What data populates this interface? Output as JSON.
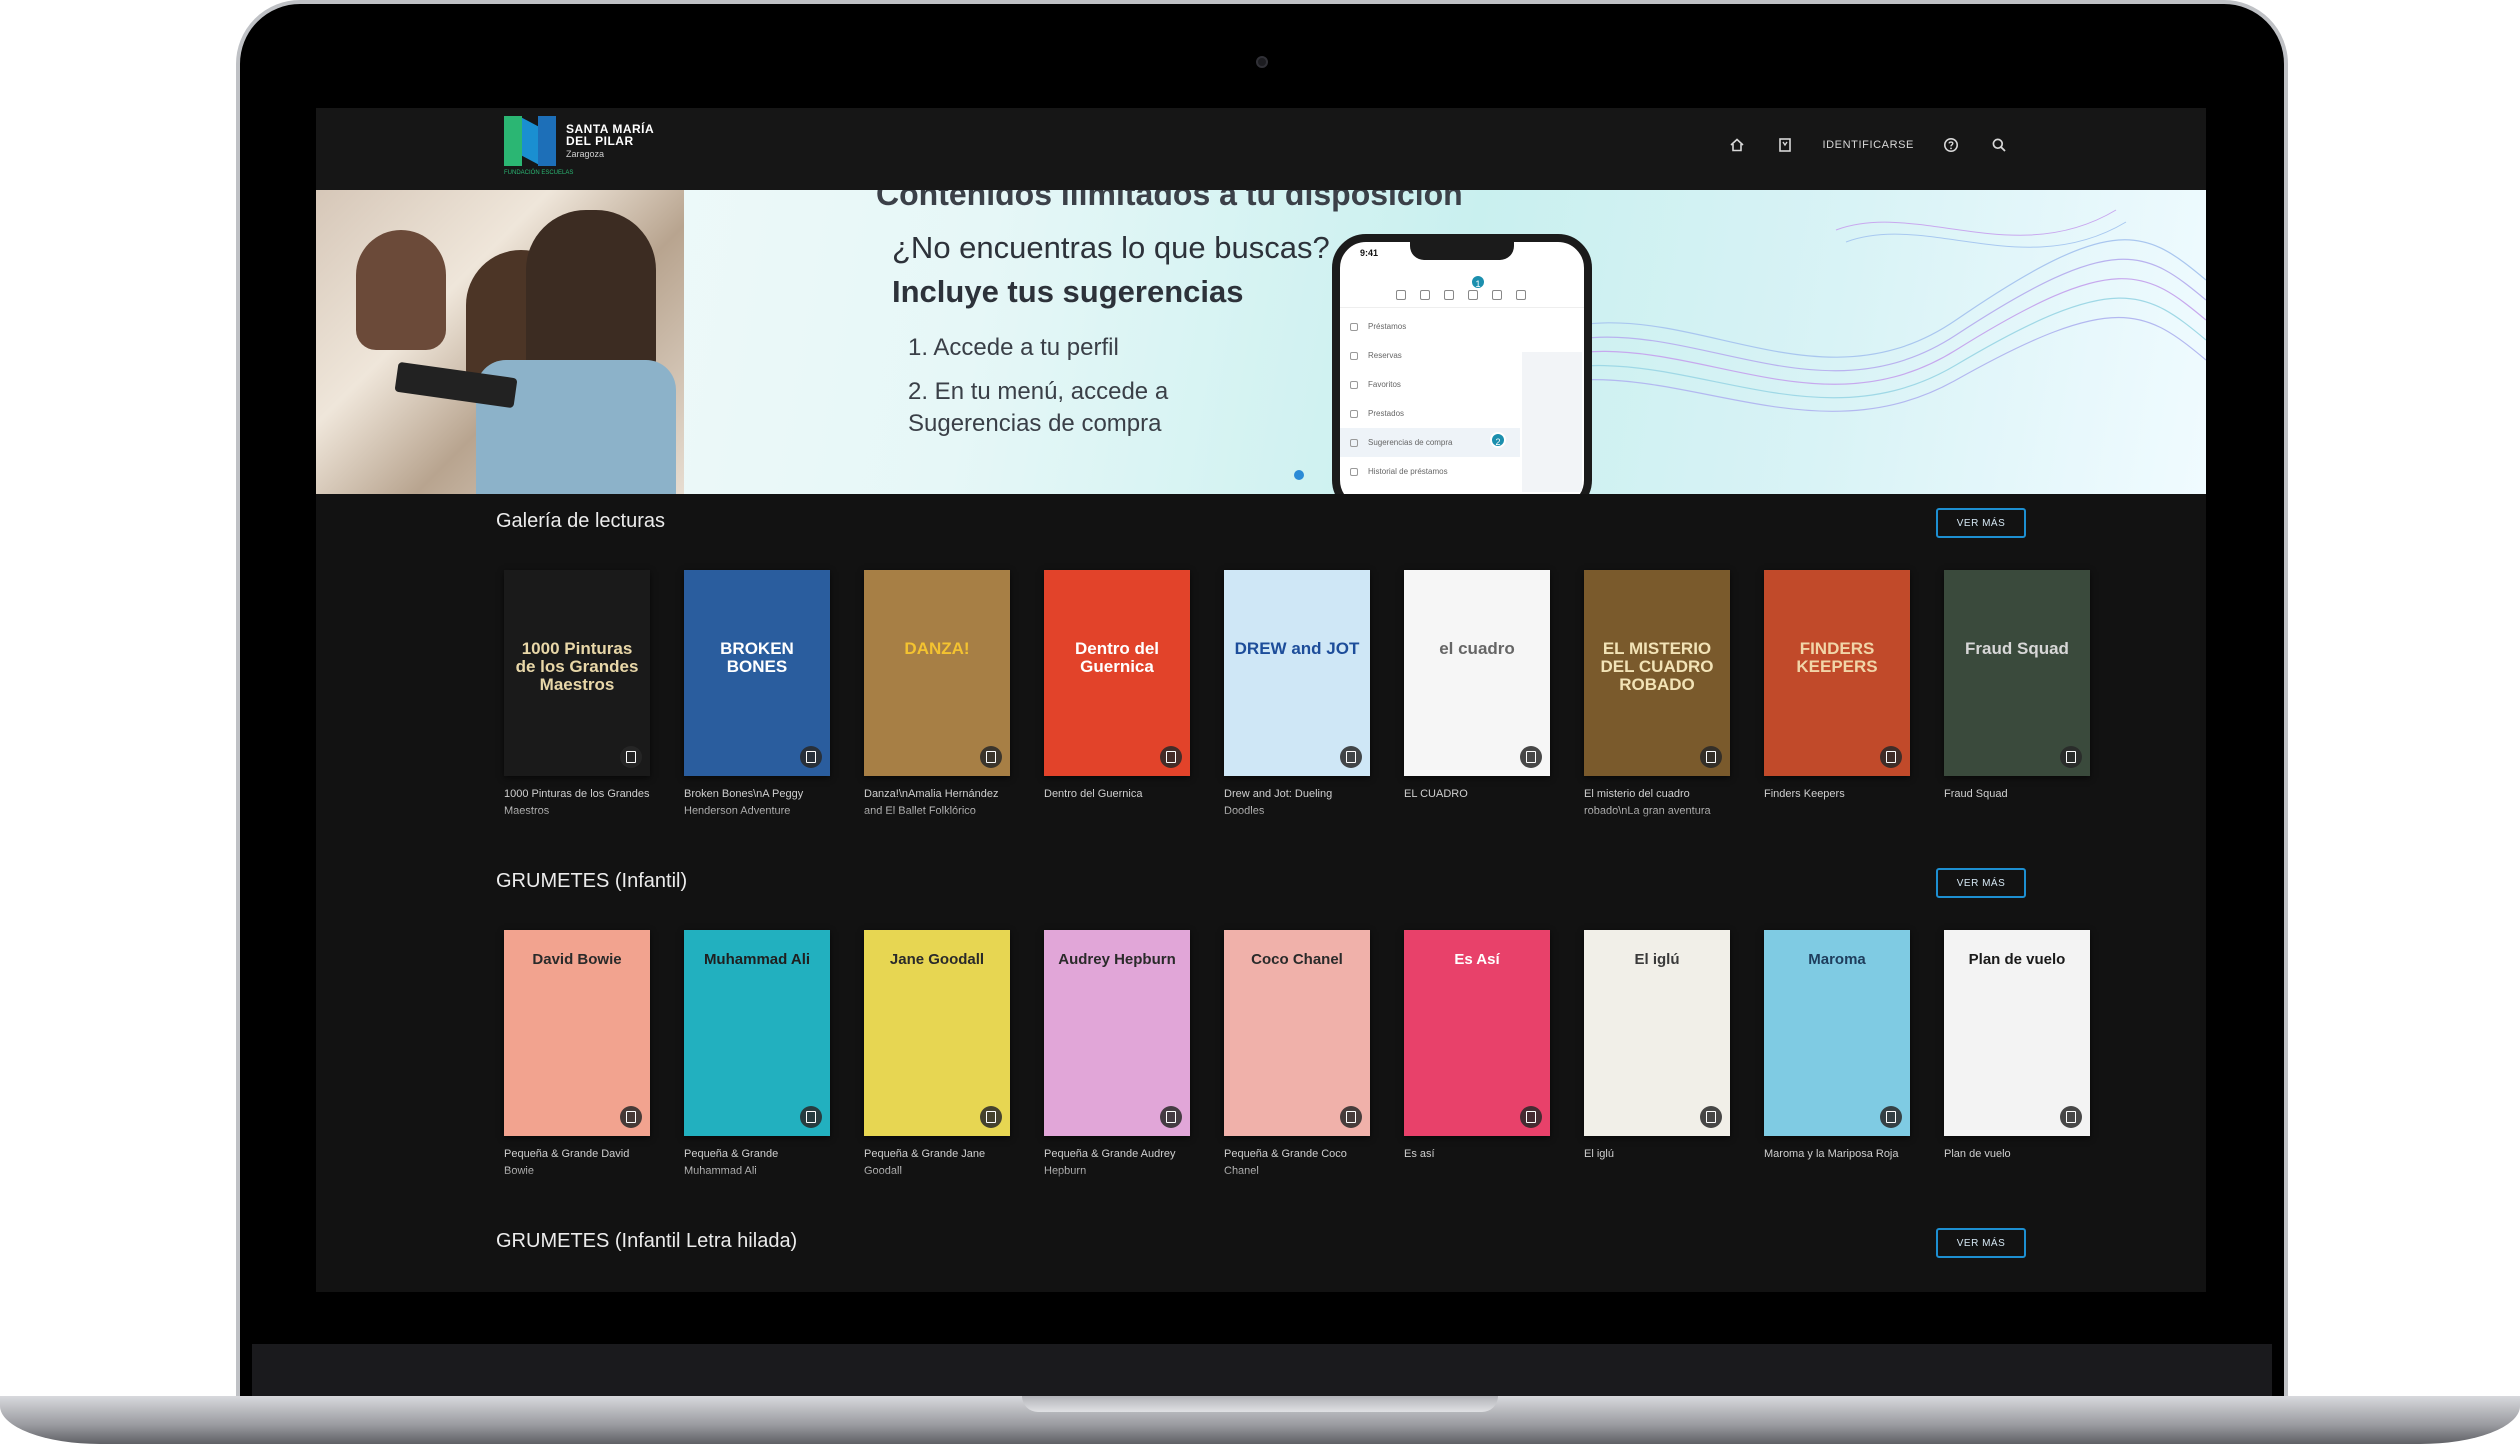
{
  "header": {
    "logo_line1": "SANTA MARÍA",
    "logo_line2": "DEL PILAR",
    "logo_line3": "Zaragoza",
    "logo_sub": "FUNDACIÓN ESCUELAS",
    "login_label": "IDENTIFICARSE",
    "icons": [
      "home-icon",
      "bookmark-icon",
      "help-icon",
      "search-icon"
    ]
  },
  "banner": {
    "headline_cut": "Contenidos ilimitados a tu disposición",
    "question": "¿No encuentras lo que buscas?",
    "subtitle": "Incluye tus sugerencias",
    "step1": "1. Accede a tu perfil",
    "step2": "2. En tu menú, accede a Sugerencias de compra",
    "phone": {
      "time": "9:41",
      "badge1": "1",
      "badge2": "2",
      "menu": [
        "Préstamos",
        "Reservas",
        "Favoritos",
        "Prestados",
        "Sugerencias de compra",
        "Historial de préstamos"
      ]
    }
  },
  "sections": [
    {
      "title": "Galería de lecturas",
      "more_label": "VER MÁS",
      "books": [
        {
          "caption": "1000 Pinturas de los Grandes Maestros",
          "cover_title": "1000 Pinturas de los Grandes Maestros",
          "bg": "#1a1a1a",
          "fg": "#e8d7a8"
        },
        {
          "caption": "Broken Bones\\nA Peggy Henderson Adventure",
          "cover_title": "BROKEN BONES",
          "bg": "#2a5d9e",
          "fg": "#ffffff"
        },
        {
          "caption": "Danza!\\nAmalia Hernández and El Ballet Folklórico",
          "cover_title": "DANZA!",
          "bg": "#a77f45",
          "fg": "#f4c330"
        },
        {
          "caption": "Dentro del Guernica",
          "cover_title": "Dentro del Guernica",
          "bg": "#e2432a",
          "fg": "#ffffff"
        },
        {
          "caption": "Drew and Jot: Dueling Doodles",
          "cover_title": "DREW and JOT",
          "bg": "#cfe7f6",
          "fg": "#1d4d9a"
        },
        {
          "caption": "EL CUADRO",
          "cover_title": "el cuadro",
          "bg": "#f6f6f6",
          "fg": "#666666"
        },
        {
          "caption": "El misterio del cuadro robado\\nLa gran aventura",
          "cover_title": "EL MISTERIO DEL CUADRO ROBADO",
          "bg": "#7a5a2c",
          "fg": "#f2e3b6"
        },
        {
          "caption": "Finders Keepers",
          "cover_title": "FINDERS KEEPERS",
          "bg": "#c14a2a",
          "fg": "#f1d5a8"
        },
        {
          "caption": "Fraud Squad",
          "cover_title": "Fraud Squad",
          "bg": "#3a4a3c",
          "fg": "#d7d7d7"
        }
      ]
    },
    {
      "title": "GRUMETES (Infantil)",
      "more_label": "VER MÁS",
      "books": [
        {
          "caption": "Pequeña & Grande David Bowie",
          "cover_title": "David Bowie",
          "bg": "#f2a38f",
          "fg": "#2a2a2a"
        },
        {
          "caption": "Pequeña & Grande Muhammad Ali",
          "cover_title": "Muhammad Ali",
          "bg": "#22b0bf",
          "fg": "#1f1f1f"
        },
        {
          "caption": "Pequeña & Grande Jane Goodall",
          "cover_title": "Jane Goodall",
          "bg": "#e7d652",
          "fg": "#2a2a2a"
        },
        {
          "caption": "Pequeña & Grande Audrey Hepburn",
          "cover_title": "Audrey Hepburn",
          "bg": "#e1a6d8",
          "fg": "#2a2a2a"
        },
        {
          "caption": "Pequeña & Grande Coco Chanel",
          "cover_title": "Coco Chanel",
          "bg": "#f0b1aa",
          "fg": "#2a2a2a"
        },
        {
          "caption": "Es así",
          "cover_title": "Es Así",
          "bg": "#e8416a",
          "fg": "#ffffff"
        },
        {
          "caption": "El iglú",
          "cover_title": "El iglú",
          "bg": "#f1efe8",
          "fg": "#3a3a3a"
        },
        {
          "caption": "Maroma y la Mariposa Roja",
          "cover_title": "Maroma",
          "bg": "#7fcbe3",
          "fg": "#1e3d5c"
        },
        {
          "caption": "Plan de vuelo",
          "cover_title": "Plan de vuelo",
          "bg": "#f3f3f3",
          "fg": "#1a1a1a"
        }
      ]
    },
    {
      "title": "GRUMETES (Infantil Letra hilada)",
      "more_label": "VER MÁS"
    }
  ]
}
